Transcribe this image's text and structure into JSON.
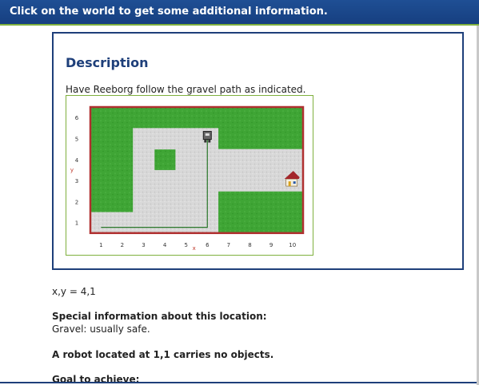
{
  "header": {
    "instruction": "Click on the world to get some additional information."
  },
  "description": {
    "title": "Description",
    "text": "Have Reeborg follow the gravel path as indicated."
  },
  "world": {
    "y_axis_label": "y",
    "x_axis_label": "x",
    "x_ticks": [
      "1",
      "2",
      "3",
      "4",
      "5",
      "6",
      "7",
      "8",
      "9",
      "10"
    ],
    "y_ticks": [
      "1",
      "2",
      "3",
      "4",
      "5",
      "6"
    ],
    "gravel_cells": [
      [
        1,
        1
      ],
      [
        2,
        1
      ],
      [
        3,
        1
      ],
      [
        4,
        1
      ],
      [
        5,
        1
      ],
      [
        6,
        1
      ],
      [
        3,
        2
      ],
      [
        4,
        2
      ],
      [
        5,
        2
      ],
      [
        6,
        2
      ],
      [
        3,
        3
      ],
      [
        4,
        3
      ],
      [
        5,
        3
      ],
      [
        6,
        3
      ],
      [
        7,
        3
      ],
      [
        8,
        3
      ],
      [
        9,
        3
      ],
      [
        10,
        3
      ],
      [
        3,
        4
      ],
      [
        5,
        4
      ],
      [
        6,
        4
      ],
      [
        7,
        4
      ],
      [
        8,
        4
      ],
      [
        9,
        4
      ],
      [
        10,
        4
      ],
      [
        3,
        5
      ],
      [
        4,
        5
      ],
      [
        5,
        5
      ],
      [
        6,
        5
      ]
    ],
    "robot_pos": [
      6,
      5
    ],
    "house_pos": [
      10,
      3
    ],
    "colors": {
      "grass": "#3fa535",
      "gravel": "#d8d8d8",
      "border": "#b03030",
      "path": "#2d7a2d"
    }
  },
  "info": {
    "coordinates": "x,y = 4,1",
    "special_heading": "Special information about this location:",
    "special_text": "Gravel: usually safe.",
    "robot_prefix": "A robot located at ",
    "robot_pos": "1,1",
    "robot_suffix": " carries no objects.",
    "goal_heading": "Goal to achieve:"
  }
}
